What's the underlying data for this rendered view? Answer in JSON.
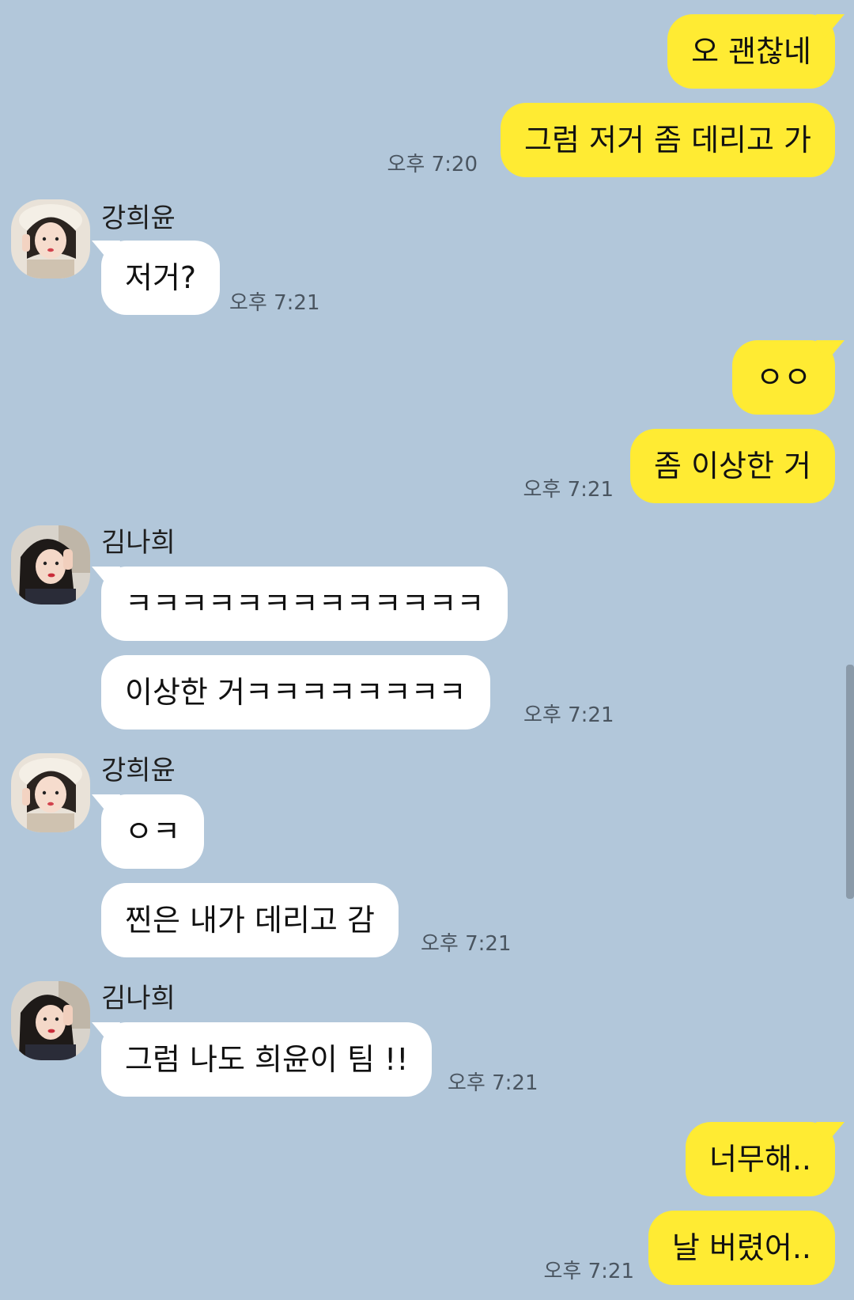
{
  "chat": {
    "time_720": "오후 7:20",
    "time_721": "오후 7:21",
    "senders": {
      "heeyun": "강희윤",
      "nahee": "김나희"
    },
    "messages": {
      "m1": "오 괜찮네",
      "m2": "그럼 저거 좀 데리고 가",
      "m3": "저거?",
      "m4": "ㅇㅇ",
      "m5": "좀 이상한 거",
      "m6": "ㅋㅋㅋㅋㅋㅋㅋㅋㅋㅋㅋㅋㅋ",
      "m7": "이상한 거ㅋㅋㅋㅋㅋㅋㅋㅋ",
      "m8": "ㅇㅋ",
      "m9": "찐은 내가 데리고 감",
      "m10": "그럼 나도 희윤이 팀 !!",
      "m11": "너무해..",
      "m12": "날 버렸어.."
    }
  },
  "colors": {
    "background": "#b2c7da",
    "my_bubble": "#ffeb33",
    "their_bubble": "#ffffff"
  }
}
